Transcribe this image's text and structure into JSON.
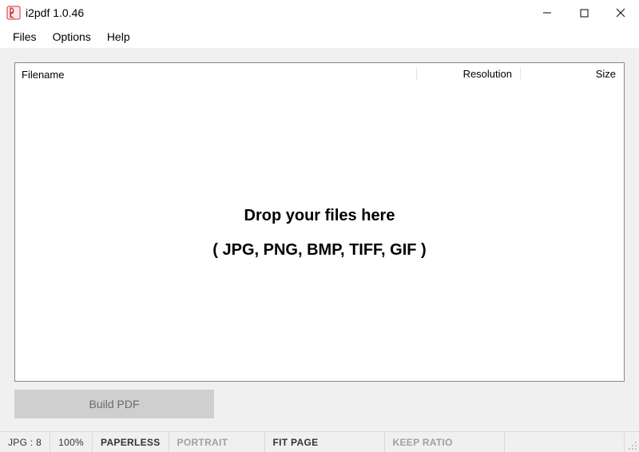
{
  "window": {
    "title": "i2pdf 1.0.46"
  },
  "menu": {
    "files": "Files",
    "options": "Options",
    "help": "Help"
  },
  "columns": {
    "filename": "Filename",
    "resolution": "Resolution",
    "size": "Size"
  },
  "drop": {
    "line1": "Drop your files here",
    "line2": "( JPG, PNG, BMP, TIFF, GIF )"
  },
  "actions": {
    "build_pdf": "Build PDF"
  },
  "status": {
    "jpg": "JPG : 8",
    "zoom": "100%",
    "paperless": "PAPERLESS",
    "orientation": "PORTRAIT",
    "fit": "FIT PAGE",
    "ratio": "KEEP RATIO"
  }
}
